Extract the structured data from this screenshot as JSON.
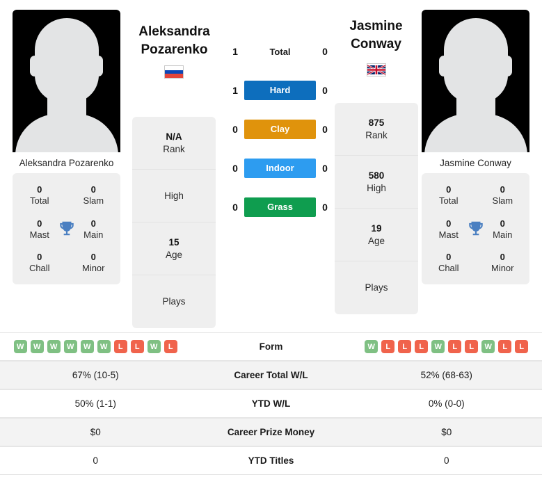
{
  "players": {
    "left": {
      "first_name": "Aleksandra",
      "last_name": "Pozarenko",
      "full_name": "Aleksandra Pozarenko",
      "country": "Russia",
      "flag_icon": "flag-russia-icon",
      "avatar_icon": "player-silhouette-icon",
      "info": [
        {
          "value": "N/A",
          "label": "Rank"
        },
        {
          "value": "",
          "label": "High"
        },
        {
          "value": "15",
          "label": "Age"
        },
        {
          "value": "",
          "label": "Plays"
        }
      ],
      "titles": [
        {
          "value": "0",
          "label": "Total"
        },
        {
          "value": "0",
          "label": "Slam"
        },
        {
          "value": "0",
          "label": "Mast"
        },
        {
          "value": "0",
          "label": "Main"
        },
        {
          "value": "0",
          "label": "Chall"
        },
        {
          "value": "0",
          "label": "Minor"
        }
      ],
      "form": [
        "W",
        "W",
        "W",
        "W",
        "W",
        "W",
        "L",
        "L",
        "W",
        "L"
      ]
    },
    "right": {
      "first_name": "Jasmine",
      "last_name": "Conway",
      "full_name": "Jasmine Conway",
      "country": "United Kingdom",
      "flag_icon": "flag-uk-icon",
      "avatar_icon": "player-silhouette-icon",
      "info": [
        {
          "value": "875",
          "label": "Rank"
        },
        {
          "value": "580",
          "label": "High"
        },
        {
          "value": "19",
          "label": "Age"
        },
        {
          "value": "",
          "label": "Plays"
        }
      ],
      "titles": [
        {
          "value": "0",
          "label": "Total"
        },
        {
          "value": "0",
          "label": "Slam"
        },
        {
          "value": "0",
          "label": "Mast"
        },
        {
          "value": "0",
          "label": "Main"
        },
        {
          "value": "0",
          "label": "Chall"
        },
        {
          "value": "0",
          "label": "Minor"
        }
      ],
      "form": [
        "W",
        "L",
        "L",
        "L",
        "W",
        "L",
        "L",
        "W",
        "L",
        "L"
      ]
    }
  },
  "trophy_icon": "trophy-icon",
  "surfaces": [
    {
      "label": "Total",
      "left": "1",
      "right": "0",
      "color": null,
      "style": "plain"
    },
    {
      "label": "Hard",
      "left": "1",
      "right": "0",
      "color": "#0d6ebd",
      "style": "bar"
    },
    {
      "label": "Clay",
      "left": "0",
      "right": "0",
      "color": "#e0930c",
      "style": "bar"
    },
    {
      "label": "Indoor",
      "left": "0",
      "right": "0",
      "color": "#2d9cf0",
      "style": "bar"
    },
    {
      "label": "Grass",
      "left": "0",
      "right": "0",
      "color": "#0f9d4f",
      "style": "bar"
    }
  ],
  "stats_table": [
    {
      "label": "Form",
      "left": null,
      "right": null,
      "type": "form",
      "shaded": false
    },
    {
      "label": "Career Total W/L",
      "left": "67% (10-5)",
      "right": "52% (68-63)",
      "type": "text",
      "shaded": true
    },
    {
      "label": "YTD W/L",
      "left": "50% (1-1)",
      "right": "0% (0-0)",
      "type": "text",
      "shaded": false
    },
    {
      "label": "Career Prize Money",
      "left": "$0",
      "right": "$0",
      "type": "text",
      "shaded": true
    },
    {
      "label": "YTD Titles",
      "left": "0",
      "right": "0",
      "type": "text",
      "shaded": false
    }
  ],
  "colors": {
    "win_badge": "#7fc083",
    "loss_badge": "#f0634c",
    "card_bg": "#efefef",
    "row_shaded": "#f3f3f3",
    "trophy": "#4a7fc1"
  }
}
